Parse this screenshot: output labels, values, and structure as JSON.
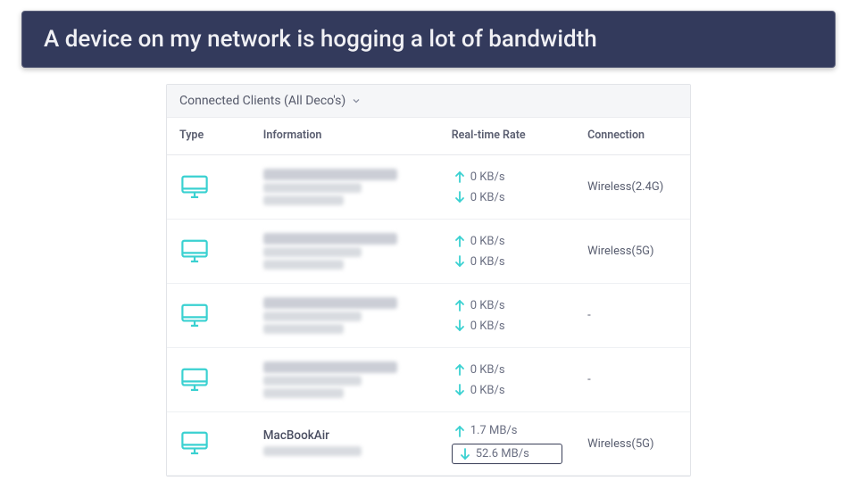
{
  "banner_text": "A device on my network is hogging a lot of bandwidth",
  "panel_title": "Connected Clients (All Deco's)",
  "columns": {
    "type": "Type",
    "information": "Information",
    "rate": "Real-time Rate",
    "connection": "Connection"
  },
  "icon_color": "#3ad1d1",
  "rows": [
    {
      "name_blurred": true,
      "name": "",
      "up": "0 KB/s",
      "down": "0 KB/s",
      "connection": "Wireless(2.4G)",
      "highlight_down": false
    },
    {
      "name_blurred": true,
      "name": "",
      "up": "0 KB/s",
      "down": "0 KB/s",
      "connection": "Wireless(5G)",
      "highlight_down": false
    },
    {
      "name_blurred": true,
      "name": "",
      "up": "0 KB/s",
      "down": "0 KB/s",
      "connection": "-",
      "highlight_down": false
    },
    {
      "name_blurred": true,
      "name": "",
      "up": "0 KB/s",
      "down": "0 KB/s",
      "connection": "-",
      "highlight_down": false
    },
    {
      "name_blurred": false,
      "name": "MacBookAir",
      "up": "1.7 MB/s",
      "down": "52.6 MB/s",
      "connection": "Wireless(5G)",
      "highlight_down": true
    }
  ]
}
